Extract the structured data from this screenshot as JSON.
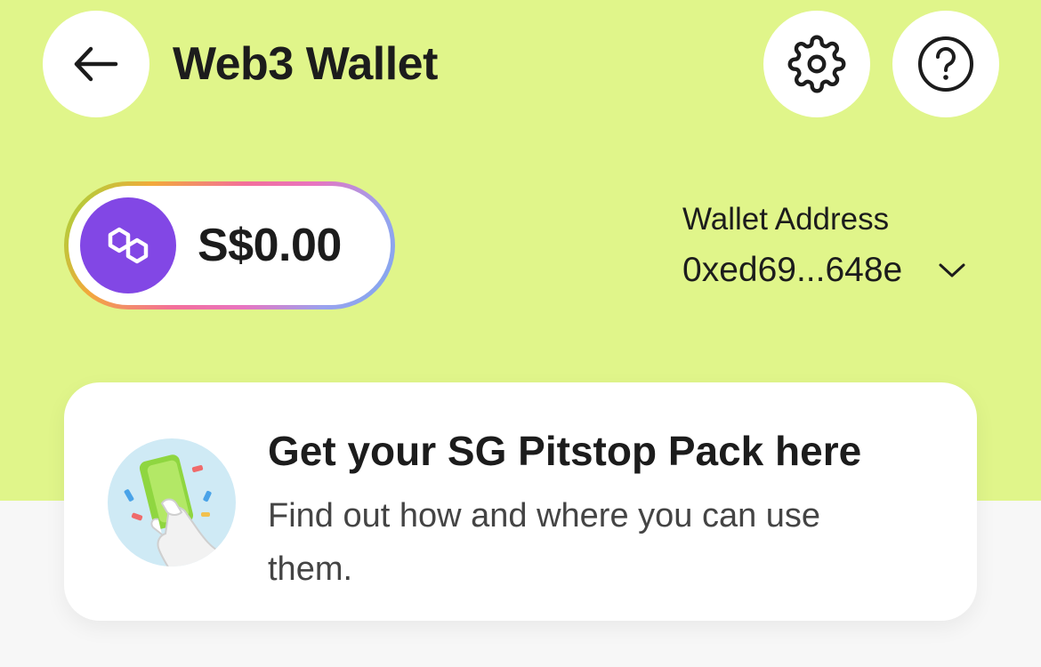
{
  "header": {
    "title": "Web3 Wallet",
    "back_icon": "arrow-left-icon",
    "settings_icon": "gear-icon",
    "help_icon": "question-circle-icon"
  },
  "balance": {
    "amount": "S$0.00",
    "chain_icon": "polygon-icon"
  },
  "wallet": {
    "label": "Wallet Address",
    "address": "0xed69...648e",
    "dropdown_icon": "chevron-down-icon"
  },
  "promo": {
    "title": "Get your SG Pitstop Pack here",
    "description": "Find out how and where you can use them.",
    "illustration": "hand-holding-card-illustration"
  },
  "colors": {
    "background_accent": "#e0f58a",
    "chain_purple": "#8247e5",
    "text": "#1c1c1c"
  }
}
